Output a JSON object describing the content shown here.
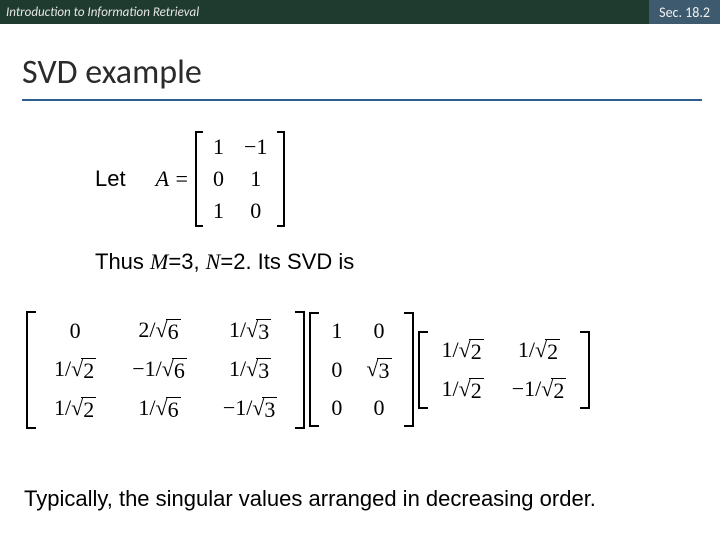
{
  "header": {
    "course": "Introduction to Information Retrieval",
    "section": "Sec. 18.2"
  },
  "title": "SVD example",
  "let_label": "Let",
  "A_label": "A =",
  "A": [
    [
      "1",
      "−1"
    ],
    [
      "0",
      "1"
    ],
    [
      "1",
      "0"
    ]
  ],
  "thus": {
    "pre": "Thus ",
    "m": "M",
    "meq": "=3, ",
    "n": "N",
    "neq": "=2. Its SVD is"
  },
  "U": [
    [
      "0",
      "2/√6",
      "1/√3"
    ],
    [
      "1/√2",
      "−1/√6",
      "1/√3"
    ],
    [
      "1/√2",
      "1/√6",
      "−1/√3"
    ]
  ],
  "S": [
    [
      "1",
      "0"
    ],
    [
      "0",
      "√3"
    ],
    [
      "0",
      "0"
    ]
  ],
  "Vt": [
    [
      "1/√2",
      "1/√2"
    ],
    [
      "1/√2",
      "−1/√2"
    ]
  ],
  "footer": "Typically, the singular values arranged in decreasing order."
}
